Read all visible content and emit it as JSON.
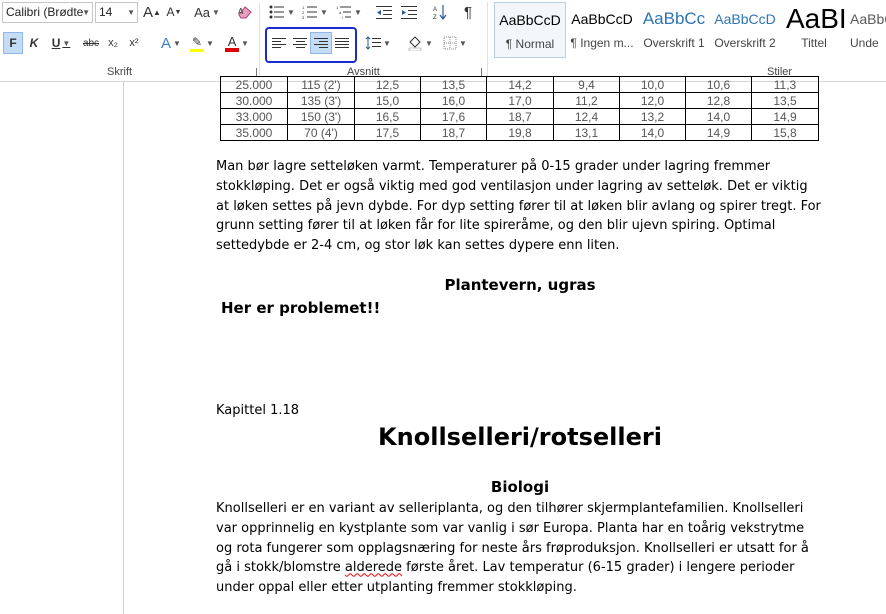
{
  "ribbon": {
    "font_name": "Calibri (Brødte",
    "font_size": "14",
    "grow_font": "A",
    "shrink_font": "A",
    "change_case": "Aa",
    "bold": "F",
    "italic": "K",
    "underline": "U",
    "strikethrough": "abc",
    "subscript": "x₂",
    "superscript": "x²",
    "text_effects": "A",
    "font_color": "A",
    "pilcrow": "¶",
    "group_font": "Skrift",
    "group_paragraph": "Avsnitt",
    "group_styles": "Stiler",
    "styles": [
      {
        "preview": "AaBbCcD",
        "name": "¶ Normal"
      },
      {
        "preview": "AaBbCcD",
        "name": "¶ Ingen m..."
      },
      {
        "preview": "AaBbCc",
        "name": "Overskrift 1"
      },
      {
        "preview": "AaBbCcD",
        "name": "Overskrift 2"
      },
      {
        "preview": "AaBI",
        "name": "Tittel"
      },
      {
        "preview": "AaBbCcD",
        "name": "Unde"
      }
    ]
  },
  "table": {
    "rows": [
      [
        "25.000",
        "115 (2')",
        "12,5",
        "13,5",
        "14,2",
        "9,4",
        "10,0",
        "10,6",
        "11,3"
      ],
      [
        "30.000",
        "135 (3')",
        "15,0",
        "16,0",
        "17,0",
        "11,2",
        "12,0",
        "12,8",
        "13,5"
      ],
      [
        "33.000",
        "150 (3')",
        "16,5",
        "17,6",
        "18,7",
        "12,4",
        "13,2",
        "14,0",
        "14,9"
      ],
      [
        "35.000",
        "70 (4')",
        "17,5",
        "18,7",
        "19,8",
        "13,1",
        "14,0",
        "14,9",
        "15,8"
      ]
    ]
  },
  "document": {
    "para1": "Man bør lagre setteløken varmt. Temperaturer på 0-15 grader under lagring fremmer stokkløping. Det er også viktig med god ventilasjon under lagring av setteløk. Det er viktig at løken settes på jevn dybde. For dyp setting fører til at løken blir avlang og spirer tregt. For grunn setting fører til at løken får for lite spireråme, og den blir ujevn spiring. Optimal settedybde er 2-4 cm, og stor løk kan settes dypere enn liten.",
    "heading_plantevern": "Plantevern, ugras",
    "problem_note": "Her er problemet!!",
    "chapter": "Kapittel 1.18",
    "title": "Knollselleri/rotselleri",
    "heading_biologi": "Biologi",
    "para2_a": "Knollselleri er en variant av selleriplanta, og den tilhører skjermplantefamilien. Knollselleri var opprinnelig en kystplante som var vanlig i sør Europa. Planta har en toårig vekstrytme og rota fungerer som opplagsnæring for neste års frøproduksjon. Knollselleri er utsatt for å gå i stokk/blomstre ",
    "para2_misspelled": "alderede",
    "para2_b": " første året. Lav temperatur (6-15 grader) i lengere perioder under oppal eller etter utplanting fremmer stokkløping."
  },
  "colors": {
    "annotation": "#1c2bd0",
    "active_button": "#c5dcf5",
    "heading_blue": "#2e74b5",
    "font_color_bar": "#e00000",
    "highlight_bar": "#ffff00"
  }
}
